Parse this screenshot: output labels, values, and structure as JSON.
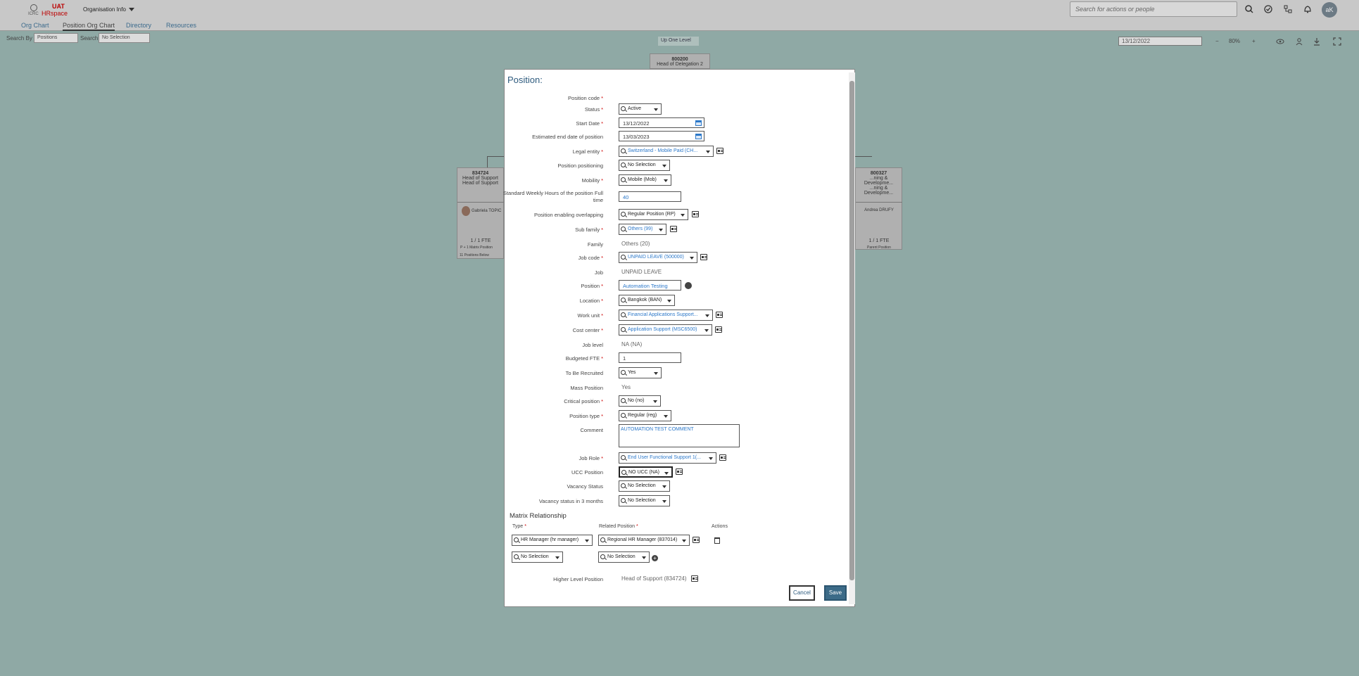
{
  "app": {
    "logo_brand": "ICRC",
    "logo_env": "UAT",
    "logo_name": "HRspace",
    "org_menu": "Organisation Info",
    "search_placeholder": "Search for actions or people",
    "avatar_initials": "aK"
  },
  "tabs": [
    "Org Chart",
    "Position Org Chart",
    "Directory",
    "Resources"
  ],
  "background": {
    "search_by_label": "Search By",
    "search_by_value": "Positions",
    "search_label": "Search",
    "search_value": "No Selection",
    "up_one_level": "Up One Level",
    "date": "13/12/2022",
    "zoom": "80%",
    "zoom_minus": "−",
    "zoom_plus": "+",
    "top_card": {
      "code": "800200",
      "title": "Head of Delegation 2"
    },
    "left_card": {
      "code": "834724",
      "title1": "Head of Support",
      "title2": "Head of Support",
      "person": "Gabriela TOPIC",
      "fte": "1 / 1 FTE",
      "extra": "P + 1 Matrix Position",
      "below": "11 Positions Below"
    },
    "right_card": {
      "code": "800327",
      "title1": "...ning & Developme...",
      "title2": "...ning & Developme...",
      "person": "Andrea DRUFY",
      "fte": "1 / 1 FTE",
      "extra": "Parent Position"
    }
  },
  "modal": {
    "title": "Position:",
    "fields": {
      "position_code": {
        "label": "Position code"
      },
      "status": {
        "label": "Status",
        "value": "Active"
      },
      "start_date": {
        "label": "Start Date",
        "value": "13/12/2022"
      },
      "end_date": {
        "label": "Estimated end date of position",
        "value": "13/03/2023"
      },
      "legal_entity": {
        "label": "Legal entity",
        "value": "Switzerland - Mobile Paid (CH..."
      },
      "position_positioning": {
        "label": "Position positioning",
        "value": "No Selection"
      },
      "mobility": {
        "label": "Mobility",
        "value": "Mobile (Mob)"
      },
      "weekly_hours": {
        "label": "Standard Weekly Hours of the position Full time",
        "value": "40"
      },
      "overlapping": {
        "label": "Position enabling overlapping",
        "value": "Regular Position (RP)"
      },
      "sub_family": {
        "label": "Sub family",
        "value": "Others (99)"
      },
      "family": {
        "label": "Family",
        "value": "Others (20)"
      },
      "job_code": {
        "label": "Job code",
        "value": "UNPAID LEAVE (500000)"
      },
      "job": {
        "label": "Job",
        "value": "UNPAID LEAVE"
      },
      "position": {
        "label": "Position",
        "value": "Automation Testing"
      },
      "location": {
        "label": "Location",
        "value": "Bangkok (BAN)"
      },
      "work_unit": {
        "label": "Work unit",
        "value": "Financial Applications Support..."
      },
      "cost_center": {
        "label": "Cost center",
        "value": "Application Support (MSC6500)"
      },
      "job_level": {
        "label": "Job level",
        "value": "NA (NA)"
      },
      "budgeted_fte": {
        "label": "Budgeted FTE",
        "value": "1"
      },
      "to_be_recruited": {
        "label": "To Be Recruited",
        "value": "Yes"
      },
      "mass_position": {
        "label": "Mass Position",
        "value": "Yes"
      },
      "critical_position": {
        "label": "Critical position",
        "value": "No (no)"
      },
      "position_type": {
        "label": "Position type",
        "value": "Regular (reg)"
      },
      "comment": {
        "label": "Comment",
        "value": "AUTOMATION TEST COMMENT"
      },
      "job_role": {
        "label": "Job Role",
        "value": "End User Functional Support 1(..."
      },
      "ucc_position": {
        "label": "UCC Position",
        "value": "NO UCC (NA)"
      },
      "vacancy_status": {
        "label": "Vacancy Status",
        "value": "No Selection"
      },
      "vacancy_status_3m": {
        "label": "Vacancy status in 3 months",
        "value": "No Selection"
      }
    },
    "matrix": {
      "title": "Matrix Relationship",
      "type_header": "Type",
      "related_header": "Related Position",
      "actions_header": "Actions",
      "rows": [
        {
          "type": "HR Manager (hr manager)",
          "related": "Regional HR Manager (837014)"
        },
        {
          "type": "No Selection",
          "related": "No Selection"
        }
      ]
    },
    "higher_level": {
      "label": "Higher Level Position",
      "value": "Head of Support (834724)"
    },
    "buttons": {
      "cancel": "Cancel",
      "save": "Save"
    },
    "required_mark": "*"
  }
}
